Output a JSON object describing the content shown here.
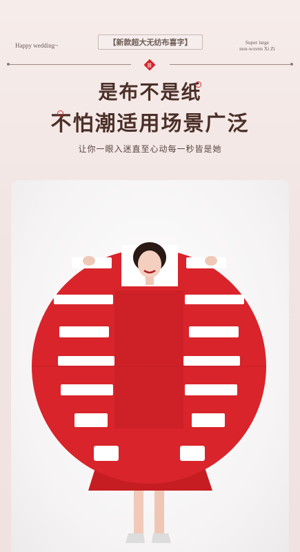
{
  "header": {
    "left_tag": "Happy wedding~",
    "right_tag_line1": "Super large",
    "right_tag_line2": "non-woven Xi Zi",
    "pill_label": "【新款超大无纺布喜字】",
    "seal_char": "囍"
  },
  "headline": {
    "line1": "是布不是纸",
    "line2": "不怕潮适用场景广泛"
  },
  "subtitle": "让你一眼入迷直至心动每一秒皆是她",
  "colors": {
    "accent_red": "#d4262c",
    "title_brown": "#4b2f28",
    "background": "#f1e5e3"
  },
  "photo": {
    "subject_icon": "woman-holding-xi-character-icon"
  }
}
